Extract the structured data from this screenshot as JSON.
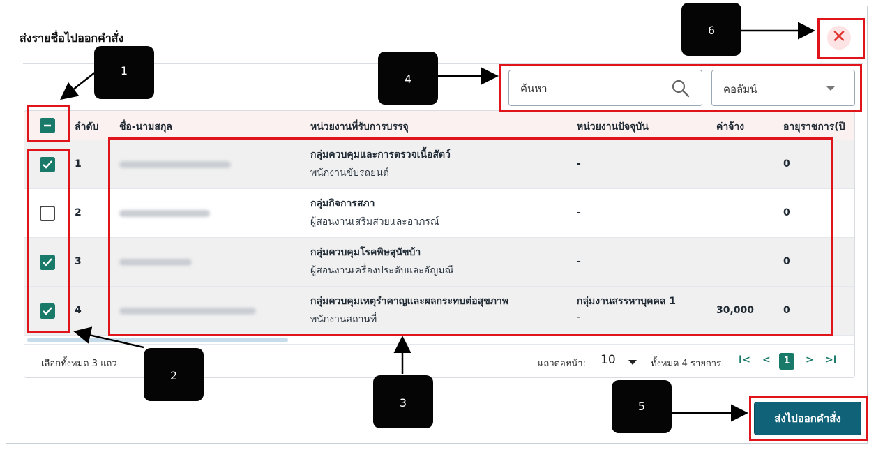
{
  "dialog": {
    "title": "ส่งรายชื่อไปออกคำสั่ง",
    "close_glyph": "✕"
  },
  "search": {
    "placeholder": "ค้นหา"
  },
  "column_filter": {
    "value": "คอลัมน์"
  },
  "table": {
    "headers": {
      "order": "ลำดับ",
      "name": "ชื่อ-นามสกุล",
      "placement_unit": "หน่วยงานที่รับการบรรจุ",
      "current_unit": "หน่วยงานปัจจุบัน",
      "wage": "ค่าจ้าง",
      "service_age": "อายุราชการ(ปี"
    },
    "rows": [
      {
        "order": "1",
        "checked": true,
        "unit": "กลุ่มควบคุมและการตรวจเนื้อสัตว์",
        "position": "พนักงานขับรถยนต์",
        "current_unit": "-",
        "current_sub": "",
        "wage": "",
        "service_age": "0"
      },
      {
        "order": "2",
        "checked": false,
        "unit": "กลุ่มกิจการสภา",
        "position": "ผู้สอนงานเสริมสวยและอาภรณ์",
        "current_unit": "-",
        "current_sub": "",
        "wage": "",
        "service_age": "0"
      },
      {
        "order": "3",
        "checked": true,
        "unit": "กลุ่มควบคุมโรคพิษสุนัขบ้า",
        "position": "ผู้สอนงานเครื่องประดับและอัญมณี",
        "current_unit": "-",
        "current_sub": "",
        "wage": "",
        "service_age": "0"
      },
      {
        "order": "4",
        "checked": true,
        "unit": "กลุ่มควบคุมเหตุรำคาญและผลกระทบต่อสุขภาพ",
        "position": "พนักงานสถานที่",
        "current_unit": "กลุ่มงานสรรหาบุคคล 1",
        "current_sub": "-",
        "wage": "30,000",
        "service_age": "0"
      }
    ]
  },
  "footer": {
    "selected_text": "เลือกทั้งหมด 3 แถว",
    "rows_per_page_label": "แถวต่อหน้า:",
    "rows_per_page_value": "10",
    "total_text": "ทั้งหมด 4 รายการ",
    "first_glyph": "I<",
    "prev_glyph": "<",
    "current_page": "1",
    "next_glyph": ">",
    "last_glyph": ">I"
  },
  "send_button": {
    "label": "ส่งไปออกคำสั่ง"
  },
  "markers": [
    "1",
    "2",
    "3",
    "4",
    "5",
    "6"
  ],
  "colors": {
    "accent": "#1a7a6a",
    "primary_button": "#0f6278",
    "highlight": "#e0151b",
    "close": "#e0332e"
  }
}
